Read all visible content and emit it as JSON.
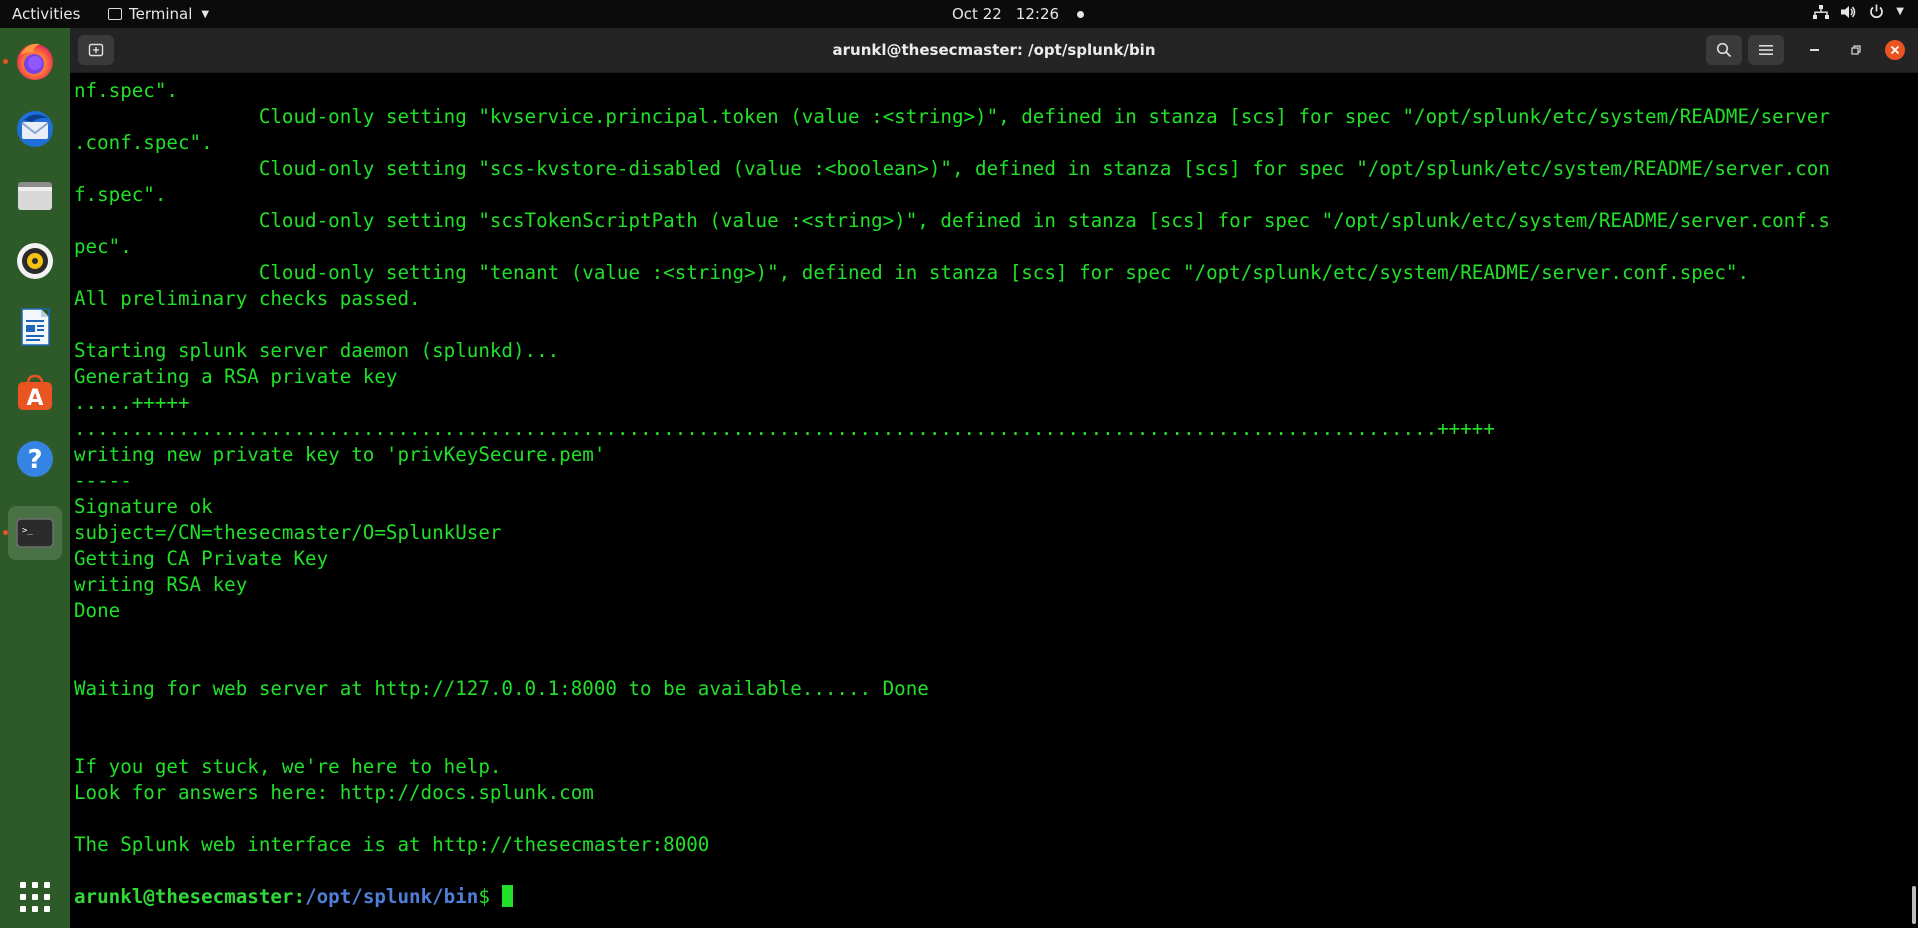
{
  "topbar": {
    "activities": "Activities",
    "app_name": "Terminal",
    "date": "Oct 22",
    "time": "12:26",
    "tray_icons": [
      "network-icon",
      "volume-icon",
      "power-icon",
      "chevron-down-icon"
    ]
  },
  "dock": {
    "items": [
      {
        "name": "firefox",
        "running": true
      },
      {
        "name": "thunderbird",
        "running": false
      },
      {
        "name": "files",
        "running": false
      },
      {
        "name": "rhythmbox",
        "running": false
      },
      {
        "name": "writer",
        "running": false
      },
      {
        "name": "software",
        "running": false
      },
      {
        "name": "help",
        "running": false
      },
      {
        "name": "terminal",
        "running": true,
        "active": true
      }
    ],
    "show_apps_icon": "grid-icon"
  },
  "window": {
    "title": "arunkl@thesecmaster: /opt/splunk/bin"
  },
  "terminal": {
    "lines": [
      "nf.spec\".",
      "                Cloud-only setting \"kvservice.principal.token (value :<string>)\", defined in stanza [scs] for spec \"/opt/splunk/etc/system/README/server",
      ".conf.spec\".",
      "                Cloud-only setting \"scs-kvstore-disabled (value :<boolean>)\", defined in stanza [scs] for spec \"/opt/splunk/etc/system/README/server.con",
      "f.spec\".",
      "                Cloud-only setting \"scsTokenScriptPath (value :<string>)\", defined in stanza [scs] for spec \"/opt/splunk/etc/system/README/server.conf.s",
      "pec\".",
      "                Cloud-only setting \"tenant (value :<string>)\", defined in stanza [scs] for spec \"/opt/splunk/etc/system/README/server.conf.spec\".",
      "All preliminary checks passed.",
      "",
      "Starting splunk server daemon (splunkd)...",
      "Generating a RSA private key",
      ".....+++++",
      "......................................................................................................................+++++",
      "writing new private key to 'privKeySecure.pem'",
      "-----",
      "Signature ok",
      "subject=/CN=thesecmaster/O=SplunkUser",
      "Getting CA Private Key",
      "writing RSA key",
      "Done",
      "",
      "",
      "Waiting for web server at http://127.0.0.1:8000 to be available...... Done",
      "",
      "",
      "If you get stuck, we're here to help.",
      "Look for answers here: http://docs.splunk.com",
      "",
      "The Splunk web interface is at http://thesecmaster:8000",
      ""
    ],
    "prompt": {
      "user_host": "arunkl@thesecmaster",
      "separator": ":",
      "path": "/opt/splunk/bin",
      "symbol": "$"
    }
  },
  "colors": {
    "terminal_text": "#22e02a",
    "prompt_path": "#4f7fd8",
    "dock_bg": "#2d5a28",
    "accent": "#e95420"
  }
}
